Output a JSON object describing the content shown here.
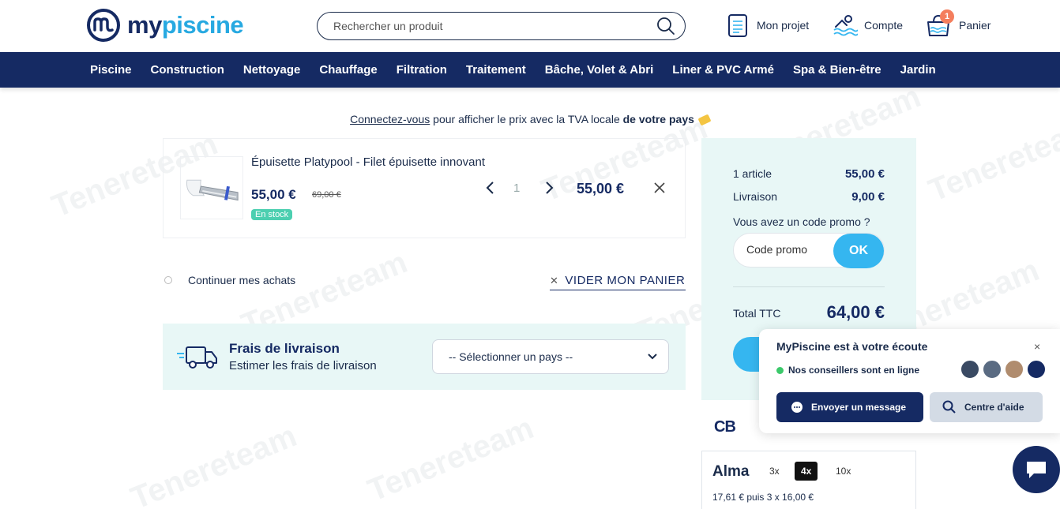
{
  "header": {
    "logo_my": "my",
    "logo_piscine": "piscine",
    "search_placeholder": "Rechercher un produit",
    "project_label": "Mon projet",
    "account_label": "Compte",
    "cart_label": "Panier",
    "cart_count": "1"
  },
  "nav": {
    "items": [
      "Piscine",
      "Construction",
      "Nettoyage",
      "Chauffage",
      "Filtration",
      "Traitement",
      "Bâche, Volet & Abri",
      "Liner & PVC Armé",
      "Spa & Bien-être",
      "Jardin"
    ]
  },
  "notice": {
    "link": "Connectez-vous",
    "text": " pour afficher le prix avec la TVA locale ",
    "bold": "de votre pays"
  },
  "cart": {
    "item": {
      "title": "Épuisette Platypool - Filet épuisette innovant",
      "price": "55,00 €",
      "old_price": "69,00 €",
      "stock": "En stock",
      "quantity": "1",
      "line_total": "55,00 €"
    },
    "continue_label": "Continuer mes achats",
    "empty_label": "VIDER MON PANIER"
  },
  "shipping": {
    "title": "Frais de livraison",
    "subtitle": "Estimer les frais de livraison",
    "country_select": "-- Sélectionner un pays --"
  },
  "summary": {
    "articles_label": "1 article",
    "articles_value": "55,00 €",
    "delivery_label": "Livraison",
    "delivery_value": "9,00 €",
    "promo_label": "Vous avez un code promo ?",
    "promo_placeholder": "Code promo",
    "promo_ok": "OK",
    "total_label": "Total TTC",
    "total_value": "64,00 €"
  },
  "payment": {
    "cb": "CB",
    "alma_logo": "Alma",
    "options": [
      "3x",
      "4x",
      "10x"
    ],
    "selected_option": "4x",
    "installments": "17,61 € puis 3 x 16,00 €"
  },
  "chat": {
    "title": "MyPiscine est à votre écoute",
    "status": "Nos conseillers sont en ligne",
    "send_label": "Envoyer un message",
    "help_label": "Centre d'aide",
    "close": "×"
  },
  "watermark": "Tenereteam",
  "colors": {
    "navy": "#152a63",
    "accent_blue": "#35b6f0",
    "mint_bg": "#e8f7f6",
    "stock_green": "#4ccfb0",
    "badge_orange": "#f47e5d"
  }
}
